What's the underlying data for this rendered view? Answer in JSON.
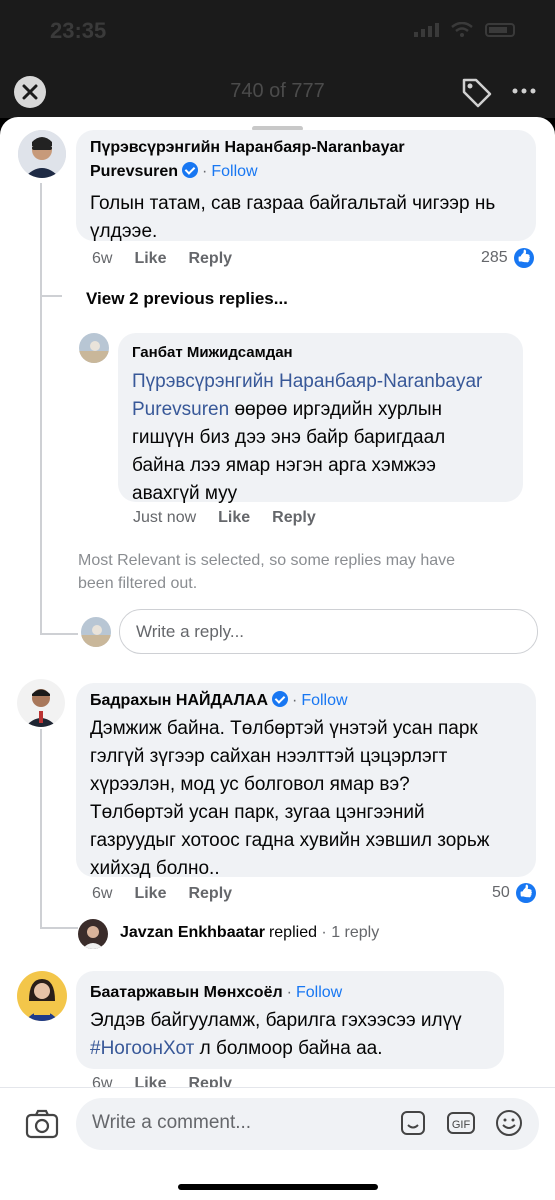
{
  "status_bar": {
    "time": "23:35"
  },
  "top_bar": {
    "counter": "740 of 777"
  },
  "comments": [
    {
      "author_line1": "Пүрэвсүрэнгийн Наранбаяр-Naranbayar",
      "author_line2": "Purevsuren",
      "follow": "Follow",
      "text_line1": "Голын татам, сав газраа байгальтай чигээр нь",
      "text_line2": "үлдээе.",
      "time": "6w",
      "like": "Like",
      "reply": "Reply",
      "reactions": "285",
      "view_previous": "View 2 previous replies...",
      "reply_item": {
        "author": "Ганбат Мижидсамдан",
        "mention_line1": "Пүрэвсүрэнгийн Наранбаяр-Naranbayar",
        "mention_line2": "Purevsuren",
        "text_line2_rest": "өөрөө иргэдийн хурлын",
        "text_line3": "гишүүн биз дээ энэ байр баригдаал",
        "text_line4": "байна лээ ямар нэгэн арга хэмжээ",
        "text_line5": "авахгүй муу",
        "time": "Just now",
        "like": "Like",
        "reply": "Reply"
      },
      "filter_note_line1": "Most Relevant is selected, so some replies may have",
      "filter_note_line2": "been filtered out.",
      "reply_placeholder": "Write a reply..."
    },
    {
      "author": "Бадрахын НАЙДАЛАА",
      "follow": "Follow",
      "text_line1": "Дэмжиж байна. Төлбөртэй үнэтэй усан парк",
      "text_line2": "гэлгүй зүгээр сайхан нээлттэй цэцэрлэгт",
      "text_line3": "хүрээлэн, мод ус болговол ямар вэ?",
      "text_line4": "Төлбөртэй усан парк, зугаа цэнгээний",
      "text_line5": "газруудыг хотоос гадна хувийн хэвшил зорьж",
      "text_line6": "хийхэд болно..",
      "time": "6w",
      "like": "Like",
      "reply": "Reply",
      "reactions": "50",
      "replied_by": "Javzan Enkhbaatar",
      "replied_word": "replied",
      "replied_count": "1 reply"
    },
    {
      "author": "Баатаржавын Мөнхсоёл",
      "follow": "Follow",
      "text_line1": "Элдэв байгууламж, барилга гэхээсээ илүү",
      "hashtag": "#НогоонХот",
      "text_line2_rest": " л болмоор байна аа.",
      "time": "6w",
      "like": "Like",
      "reply": "Reply"
    }
  ],
  "composer": {
    "placeholder": "Write a comment..."
  },
  "colors": {
    "accent": "#1877f2",
    "bubble": "#f0f2f5",
    "mention": "#385898"
  }
}
